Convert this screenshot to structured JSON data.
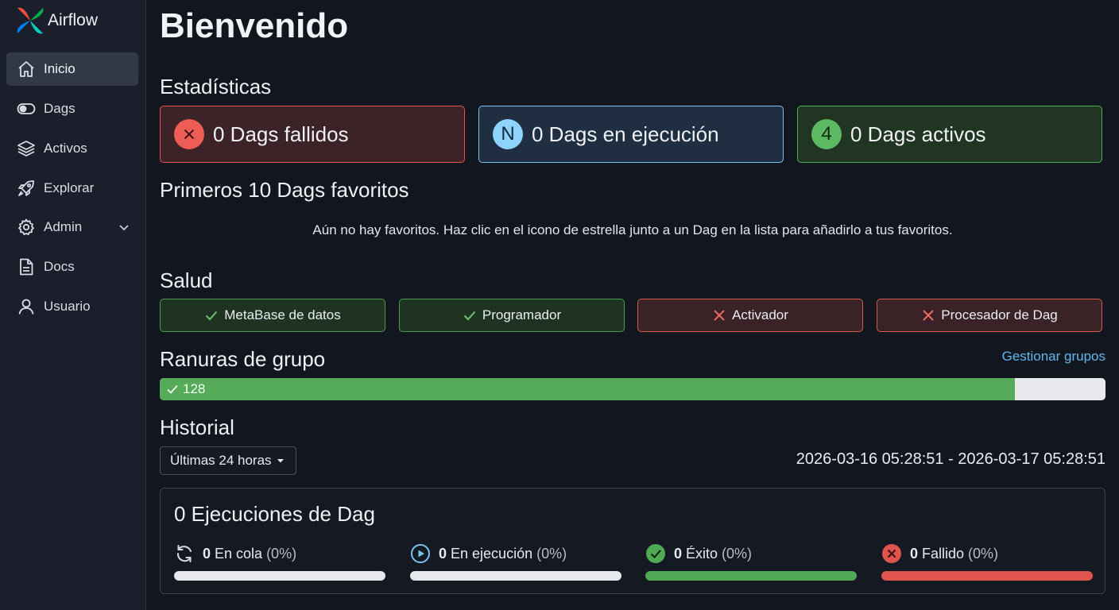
{
  "app": {
    "name": "Airflow"
  },
  "sidebar": {
    "items": [
      {
        "label": "Inicio",
        "icon": "home-icon",
        "active": true
      },
      {
        "label": "Dags",
        "icon": "toggle-icon"
      },
      {
        "label": "Activos",
        "icon": "layers-icon"
      },
      {
        "label": "Explorar",
        "icon": "rocket-icon"
      },
      {
        "label": "Admin",
        "icon": "gear-icon",
        "has_submenu": true
      },
      {
        "label": "Docs",
        "icon": "document-icon"
      },
      {
        "label": "Usuario",
        "icon": "user-icon"
      }
    ]
  },
  "page": {
    "title": "Bienvenido"
  },
  "stats": {
    "title": "Estadísticas",
    "failed": {
      "badge": "×",
      "label": "0 Dags fallidos",
      "color": "#e5534b"
    },
    "running": {
      "badge": "N",
      "label": "0 Dags en ejecución",
      "color": "#7cc3f2"
    },
    "active": {
      "badge": "4",
      "label": "0 Dags activos",
      "color": "#4fae54"
    }
  },
  "favorites": {
    "title": "Primeros 10 Dags favoritos",
    "empty_message": "Aún no hay favoritos. Haz clic en el icono de estrella junto a un Dag en la lista para añadirlo a tus favoritos."
  },
  "health": {
    "title": "Salud",
    "items": [
      {
        "label": "MetaBase de datos",
        "status": "ok"
      },
      {
        "label": "Programador",
        "status": "ok"
      },
      {
        "label": "Activador",
        "status": "error"
      },
      {
        "label": "Procesador de Dag",
        "status": "error"
      }
    ]
  },
  "pools": {
    "title": "Ranuras de grupo",
    "manage_link": "Gestionar grupos",
    "open_slots": "128",
    "fill_fraction": 0.904
  },
  "history": {
    "title": "Historial",
    "range_select": "Últimas 24 horas",
    "date_range": "2026-03-16 05:28:51 - 2026-03-17 05:28:51",
    "runs_title": "0 Ejecuciones de Dag",
    "runs": [
      {
        "count": "0",
        "label": "En cola",
        "pct": "(0%)",
        "icon": "refresh-icon",
        "bar_color": "#e6e8eb"
      },
      {
        "count": "0",
        "label": "En ejecución",
        "pct": "(0%)",
        "icon": "play-circle-icon",
        "bar_color": "#e6e8eb"
      },
      {
        "count": "0",
        "label": "Éxito",
        "pct": "(0%)",
        "icon": "check-circle-icon",
        "bar_color": "#4fa955"
      },
      {
        "count": "0",
        "label": "Fallido",
        "pct": "(0%)",
        "icon": "x-circle-icon",
        "bar_color": "#e05450"
      }
    ]
  },
  "colors": {
    "accent_link": "#63b7ec",
    "success": "#55ab58",
    "failure": "#e05450",
    "running": "#7cc3f2"
  }
}
